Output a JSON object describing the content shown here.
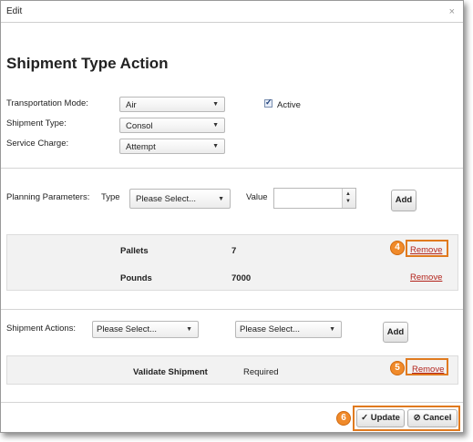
{
  "dialog": {
    "title": "Edit",
    "close_glyph": "×"
  },
  "heading": "Shipment Type Action",
  "form": {
    "transportation_mode": {
      "label": "Transportation Mode:",
      "value": "Air"
    },
    "shipment_type": {
      "label": "Shipment Type:",
      "value": "Consol"
    },
    "service_charge": {
      "label": "Service Charge:",
      "value": "Attempt"
    },
    "active": {
      "label": "Active",
      "checked": true
    }
  },
  "planning": {
    "label": "Planning Parameters:",
    "type_label": "Type",
    "type_value": "Please Select...",
    "value_label": "Value",
    "value_input": "",
    "add_label": "Add",
    "rows": [
      {
        "name": "Pallets",
        "value": "7",
        "action": "Remove"
      },
      {
        "name": "Pounds",
        "value": "7000",
        "action": "Remove"
      }
    ]
  },
  "shipment_actions": {
    "label": "Shipment Actions:",
    "select1": "Please Select...",
    "select2": "Please Select...",
    "add_label": "Add",
    "rows": [
      {
        "name": "Validate Shipment",
        "value": "Required",
        "action": "Remove"
      }
    ]
  },
  "footer": {
    "update_label": "Update",
    "cancel_label": "Cancel"
  },
  "callouts": {
    "badge4": "4",
    "badge5": "5",
    "badge6": "6"
  },
  "icons": {
    "update": "check-icon",
    "cancel": "cancel-circle-icon",
    "dropdown": "triangle-down-icon",
    "spinner": "spinner-arrows-icon"
  },
  "colors": {
    "callout": "#e07a1f",
    "remove_link": "#b3241c"
  }
}
